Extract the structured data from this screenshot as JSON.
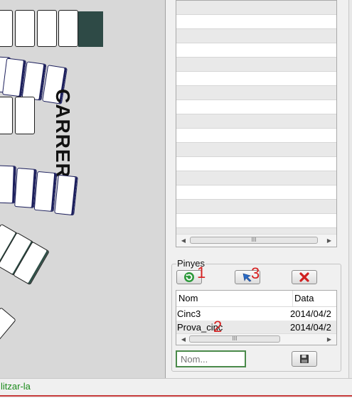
{
  "canvas": {
    "street_label": "CARRER",
    "colors": {
      "dark_block": "#2e4a46",
      "navy_edge": "#1c1f5c"
    }
  },
  "panel": {
    "group_title": "Pinyes",
    "buttons": {
      "refresh_icon": "refresh-icon",
      "pointer_icon": "cursor-arrow-icon",
      "delete_icon": "close-icon",
      "save_icon": "floppy-disk-icon"
    },
    "annotations": [
      "1",
      "3",
      "2"
    ],
    "list": {
      "columns": [
        "Nom",
        "Data"
      ],
      "rows": [
        {
          "nom": "Cinc3",
          "data": "2014/04/2"
        },
        {
          "nom": "Prova_cinc",
          "data": "2014/04/2"
        }
      ]
    },
    "name_input": {
      "placeholder": "Nom...",
      "value": ""
    },
    "scrollbar_grip": "III"
  },
  "status_bar": {
    "text": "litzar-la"
  }
}
